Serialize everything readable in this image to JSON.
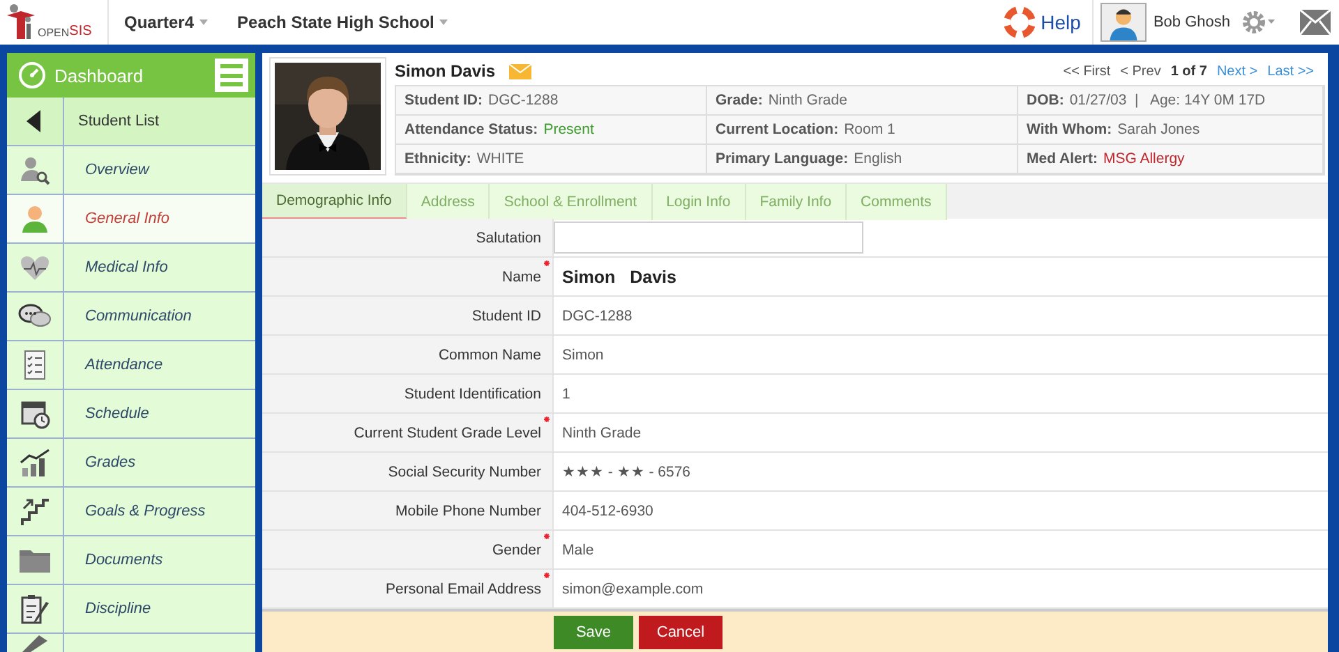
{
  "topbar": {
    "logo": {
      "text_a": "OPEN",
      "text_b": "SIS"
    },
    "menus": [
      {
        "label": "Quarter4"
      },
      {
        "label": "Peach State High School"
      }
    ],
    "help": "Help",
    "user": "Bob Ghosh"
  },
  "sidebar": {
    "title": "Dashboard",
    "items": [
      {
        "label": "Student List",
        "kind": "back",
        "selected": false
      },
      {
        "label": "Overview",
        "kind": "link",
        "selected": false
      },
      {
        "label": "General Info",
        "kind": "link",
        "selected": true
      },
      {
        "label": "Medical Info",
        "kind": "link",
        "selected": false
      },
      {
        "label": "Communication",
        "kind": "link",
        "selected": false
      },
      {
        "label": "Attendance",
        "kind": "link",
        "selected": false
      },
      {
        "label": "Schedule",
        "kind": "link",
        "selected": false
      },
      {
        "label": "Grades",
        "kind": "link",
        "selected": false
      },
      {
        "label": "Goals & Progress",
        "kind": "link",
        "selected": false
      },
      {
        "label": "Documents",
        "kind": "link",
        "selected": false
      },
      {
        "label": "Discipline",
        "kind": "link",
        "selected": false
      },
      {
        "kind": "partial",
        "selected": false
      }
    ]
  },
  "student": {
    "name": "Simon Davis",
    "pager": [
      {
        "label": "<< First",
        "kind": "link",
        "disabled": true
      },
      {
        "label": "< Prev",
        "kind": "link",
        "disabled": true
      },
      {
        "label": "1 of 7",
        "kind": "position"
      },
      {
        "label": "Next >",
        "kind": "link",
        "disabled": false
      },
      {
        "label": "Last >>",
        "kind": "link",
        "disabled": false
      }
    ],
    "info": [
      {
        "label": "Student ID:",
        "value": "DGC-1288",
        "color": "#666666"
      },
      {
        "label": "Grade:",
        "value": "Ninth Grade",
        "color": "#666666"
      },
      {
        "label": "DOB:",
        "value": "01/27/03  |   Age: 14Y 0M 17D",
        "color": "#666666"
      },
      {
        "label": "Attendance Status:",
        "value": "Present",
        "color": "#3a9a2a"
      },
      {
        "label": "Current Location:",
        "value": "Room 1",
        "color": "#666666"
      },
      {
        "label": "With Whom:",
        "value": "Sarah Jones",
        "color": "#666666"
      },
      {
        "label": "Ethnicity:",
        "value": "WHITE",
        "color": "#666666"
      },
      {
        "label": "Primary Language:",
        "value": "English",
        "color": "#666666"
      },
      {
        "label": "Med Alert:",
        "value": "MSG Allergy",
        "color": "#c0272d"
      }
    ]
  },
  "tabs": [
    {
      "label": "Demographic Info",
      "selected": true
    },
    {
      "label": "Address",
      "selected": false
    },
    {
      "label": "School & Enrollment",
      "selected": false
    },
    {
      "label": "Login Info",
      "selected": false
    },
    {
      "label": "Family Info",
      "selected": false
    },
    {
      "label": "Comments",
      "selected": false
    }
  ],
  "form": [
    {
      "label": "Salutation",
      "kind": "input",
      "required": false
    },
    {
      "label": "Name",
      "kind": "bold",
      "value": "Simon   Davis",
      "required": true
    },
    {
      "label": "Student ID",
      "kind": "text",
      "value": "DGC-1288",
      "required": false
    },
    {
      "label": "Common Name",
      "kind": "text",
      "value": "Simon",
      "required": false
    },
    {
      "label": "Student Identification",
      "kind": "text",
      "value": "1",
      "required": false
    },
    {
      "label": "Current Student Grade Level",
      "kind": "text",
      "value": "Ninth Grade",
      "required": true
    },
    {
      "label": "Social Security Number",
      "kind": "text",
      "value": "★★★ - ★★ - 6576",
      "required": false
    },
    {
      "label": "Mobile Phone Number",
      "kind": "text",
      "value": "404-512-6930",
      "required": false
    },
    {
      "label": "Gender",
      "kind": "text",
      "value": "Male",
      "required": true
    },
    {
      "label": "Personal Email Address",
      "kind": "text",
      "value": "simon@example.com",
      "required": true
    }
  ],
  "buttons": [
    {
      "label": "Save",
      "kind": "save"
    },
    {
      "label": "Cancel",
      "kind": "cancel"
    }
  ]
}
